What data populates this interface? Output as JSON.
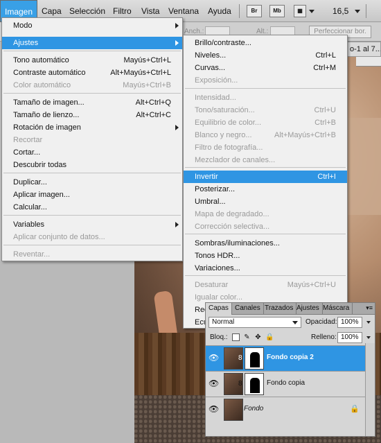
{
  "menubar": {
    "items": [
      "Imagen",
      "Capa",
      "Selección",
      "Filtro",
      "Vista",
      "Ventana",
      "Ayuda"
    ],
    "br_label": "Br",
    "mb_label": "Mb",
    "zoom": "16,5"
  },
  "options": {
    "anch_label": "Anch.:",
    "alt_label": "Alt.:",
    "refine_label": "Perfeccionar bor."
  },
  "document_tab": "o-1 al 7...",
  "menu_imagen": {
    "items": [
      {
        "label": "Modo",
        "shortcut": "",
        "submenu": true,
        "disabled": false
      },
      {
        "label": "Ajustes",
        "shortcut": "",
        "submenu": true,
        "disabled": false,
        "selected": true
      },
      {
        "label": "Tono automático",
        "shortcut": "Mayús+Ctrl+L",
        "submenu": false,
        "disabled": false
      },
      {
        "label": "Contraste automático",
        "shortcut": "Alt+Mayús+Ctrl+L",
        "submenu": false,
        "disabled": false
      },
      {
        "label": "Color automático",
        "shortcut": "Mayús+Ctrl+B",
        "submenu": false,
        "disabled": true
      },
      {
        "label": "Tamaño de imagen...",
        "shortcut": "Alt+Ctrl+Q",
        "submenu": false,
        "disabled": false
      },
      {
        "label": "Tamaño de lienzo...",
        "shortcut": "Alt+Ctrl+C",
        "submenu": false,
        "disabled": false
      },
      {
        "label": "Rotación de imagen",
        "shortcut": "",
        "submenu": true,
        "disabled": false
      },
      {
        "label": "Recortar",
        "shortcut": "",
        "submenu": false,
        "disabled": true
      },
      {
        "label": "Cortar...",
        "shortcut": "",
        "submenu": false,
        "disabled": false
      },
      {
        "label": "Descubrir todas",
        "shortcut": "",
        "submenu": false,
        "disabled": false
      },
      {
        "label": "Duplicar...",
        "shortcut": "",
        "submenu": false,
        "disabled": false
      },
      {
        "label": "Aplicar imagen...",
        "shortcut": "",
        "submenu": false,
        "disabled": false
      },
      {
        "label": "Calcular...",
        "shortcut": "",
        "submenu": false,
        "disabled": false
      },
      {
        "label": "Variables",
        "shortcut": "",
        "submenu": true,
        "disabled": false
      },
      {
        "label": "Aplicar conjunto de datos...",
        "shortcut": "",
        "submenu": false,
        "disabled": true
      },
      {
        "label": "Reventar...",
        "shortcut": "",
        "submenu": false,
        "disabled": true
      }
    ]
  },
  "menu_ajustes": {
    "items": [
      {
        "label": "Brillo/contraste...",
        "shortcut": "",
        "disabled": false
      },
      {
        "label": "Niveles...",
        "shortcut": "Ctrl+L",
        "disabled": false
      },
      {
        "label": "Curvas...",
        "shortcut": "Ctrl+M",
        "disabled": false
      },
      {
        "label": "Exposición...",
        "shortcut": "",
        "disabled": true
      },
      {
        "label": "Intensidad...",
        "shortcut": "",
        "disabled": true
      },
      {
        "label": "Tono/saturación...",
        "shortcut": "Ctrl+U",
        "disabled": true
      },
      {
        "label": "Equilibrio de color...",
        "shortcut": "Ctrl+B",
        "disabled": true
      },
      {
        "label": "Blanco y negro...",
        "shortcut": "Alt+Mayús+Ctrl+B",
        "disabled": true
      },
      {
        "label": "Filtro de fotografía...",
        "shortcut": "",
        "disabled": true
      },
      {
        "label": "Mezclador de canales...",
        "shortcut": "",
        "disabled": true
      },
      {
        "label": "Invertir",
        "shortcut": "Ctrl+I",
        "disabled": false,
        "selected": true
      },
      {
        "label": "Posterizar...",
        "shortcut": "",
        "disabled": false
      },
      {
        "label": "Umbral...",
        "shortcut": "",
        "disabled": false
      },
      {
        "label": "Mapa de degradado...",
        "shortcut": "",
        "disabled": true
      },
      {
        "label": "Corrección selectiva...",
        "shortcut": "",
        "disabled": true
      },
      {
        "label": "Sombras/iluminaciones...",
        "shortcut": "",
        "disabled": false
      },
      {
        "label": "Tonos HDR...",
        "shortcut": "",
        "disabled": false
      },
      {
        "label": "Variaciones...",
        "shortcut": "",
        "disabled": false
      },
      {
        "label": "Desaturar",
        "shortcut": "Mayús+Ctrl+U",
        "disabled": true
      },
      {
        "label": "Igualar color...",
        "shortcut": "",
        "disabled": true
      },
      {
        "label": "Ree",
        "shortcut": "",
        "disabled": false
      },
      {
        "label": "Ecu",
        "shortcut": "",
        "disabled": false
      }
    ]
  },
  "layers_panel": {
    "tabs": [
      "Capas",
      "Canales",
      "Trazados",
      "Ajustes",
      "Máscara"
    ],
    "blend_mode": "Normal",
    "opacity_label": "Opacidad:",
    "opacity_value": "100%",
    "lock_label": "Bloq.:",
    "fill_label": "Relleno:",
    "fill_value": "100%",
    "layers": [
      {
        "name": "Fondo copia 2",
        "selected": true,
        "mask": true
      },
      {
        "name": "Fondo copia",
        "selected": false,
        "mask": true
      },
      {
        "name": "Fondo",
        "selected": false,
        "mask": false,
        "locked": true
      }
    ]
  }
}
